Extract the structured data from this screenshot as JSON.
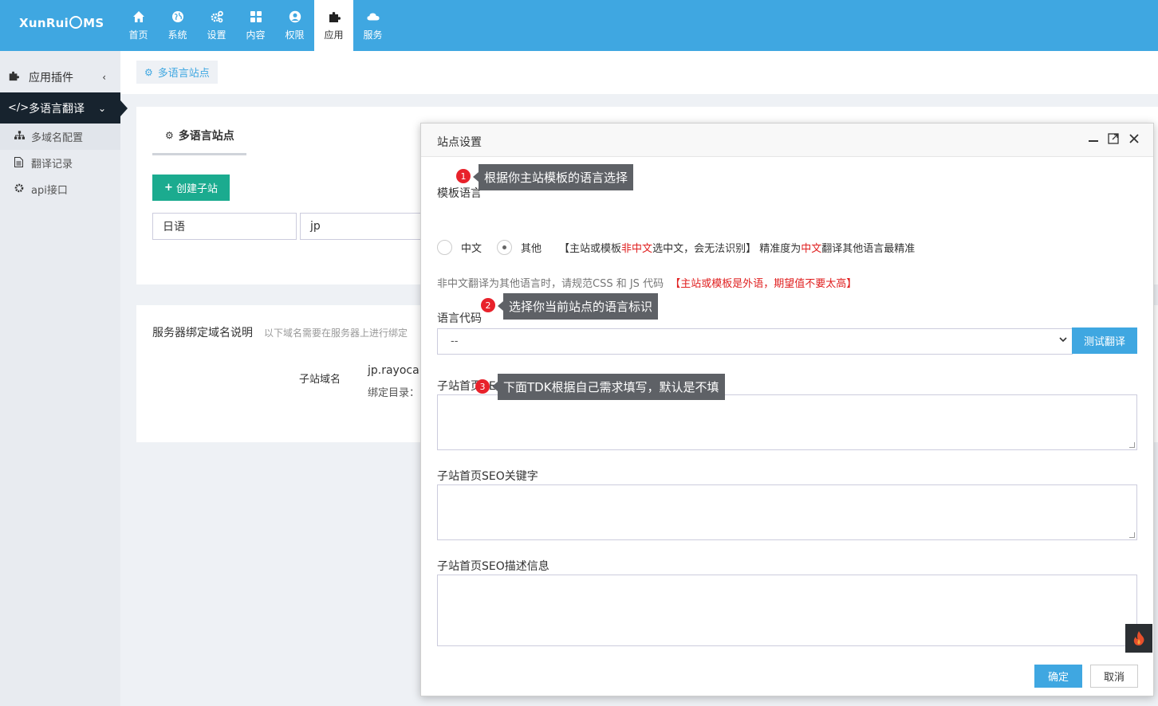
{
  "brand": {
    "logo_text": "XunRuiCMS"
  },
  "nav": [
    {
      "label": "首页",
      "icon": "home-icon"
    },
    {
      "label": "系统",
      "icon": "globe-icon"
    },
    {
      "label": "设置",
      "icon": "gears-icon"
    },
    {
      "label": "内容",
      "icon": "grid-icon"
    },
    {
      "label": "权限",
      "icon": "user-icon"
    },
    {
      "label": "应用",
      "icon": "puzzle-icon",
      "active": true
    },
    {
      "label": "服务",
      "icon": "cloud-icon"
    }
  ],
  "sidebar": {
    "groups": [
      {
        "label": "应用插件",
        "icon": "puzzle-icon",
        "chevron": "‹"
      },
      {
        "label": "多语言翻译",
        "icon": "code-icon",
        "chevron": "⌄",
        "active": true
      }
    ],
    "items": [
      {
        "label": "多域名配置",
        "icon": "sitemap-icon"
      },
      {
        "label": "翻译记录",
        "icon": "file-icon"
      },
      {
        "label": "api接口",
        "icon": "gear-icon"
      }
    ]
  },
  "breadcrumb": {
    "label": "多语言站点"
  },
  "panel": {
    "tab_title": "多语言站点",
    "create_button": "创建子站",
    "row": {
      "name": "日语",
      "code": "jp"
    }
  },
  "binding": {
    "title": "服务器绑定域名说明",
    "note": "以下域名需要在服务器上进行绑定",
    "label": "子站域名",
    "domain": "jp.rayocab",
    "dir_label": "绑定目录："
  },
  "modal": {
    "title": "站点设置",
    "template_lang_label": "模板语言",
    "radio_options": [
      "中文",
      "其他"
    ],
    "radio_selected": "其他",
    "hint_parts": [
      "【主站或模板",
      "非中文",
      "选中文，会无法识别】 精准度为",
      "中文",
      "翻译其他语言最精准"
    ],
    "help_text": "非中文翻译为其他语言时，请规范CSS 和 JS 代码",
    "help_warn": "【主站或模板是外语，期望值不要太高】",
    "lang_code_label": "语言代码",
    "select_value": "--",
    "test_button": "测试翻译",
    "seo_title_label": "子站首页SEO标题",
    "seo_keywords_label": "子站首页SEO关键字",
    "seo_desc_label": "子站首页SEO描述信息",
    "ok_button": "确定",
    "cancel_button": "取消"
  },
  "tips": [
    {
      "num": "1",
      "text": "根据你主站模板的语言选择"
    },
    {
      "num": "2",
      "text": "选择你当前站点的语言标识"
    },
    {
      "num": "3",
      "text": "下面TDK根据自己需求填写，默认是不填"
    }
  ],
  "colors": {
    "primary": "#3fa7e1",
    "green": "#1bab8f",
    "sidebar_dark": "#17232e",
    "red": "#e8222b"
  }
}
